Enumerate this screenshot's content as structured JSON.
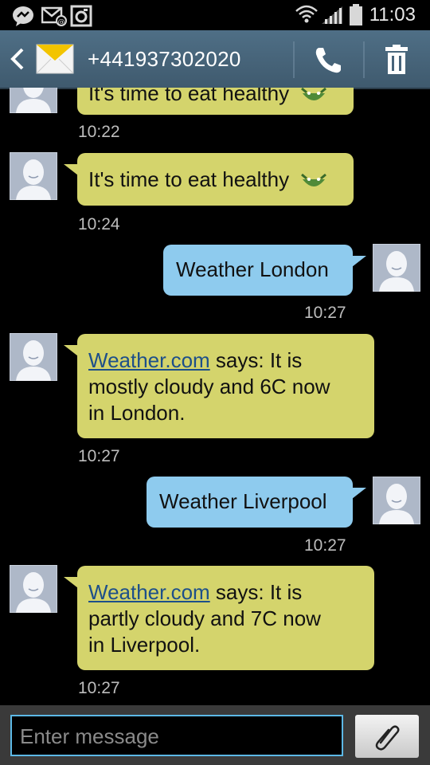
{
  "status_bar": {
    "time": "11:03",
    "icons": [
      "messenger-icon",
      "mail-notification-icon",
      "gallery-icon",
      "wifi-icon",
      "signal-icon",
      "battery-icon"
    ]
  },
  "header": {
    "contact_number": "+441937302020",
    "icons": [
      "back-arrow-icon",
      "envelope-icon",
      "phone-icon",
      "trash-icon"
    ]
  },
  "messages": [
    {
      "direction": "in",
      "text": "It's time to eat healthy",
      "time": "10:22",
      "emoji": "smiling-face-icon",
      "partially_visible": true
    },
    {
      "direction": "in",
      "text": "It's time to eat healthy",
      "time": "10:24",
      "emoji": "smiling-face-icon"
    },
    {
      "direction": "out",
      "text": "Weather London",
      "time": "10:27"
    },
    {
      "direction": "in",
      "link": "Weather.com",
      "line1_rest": " says: It is",
      "line2": "mostly cloudy and 6C now",
      "line3": "in London.",
      "time": "10:27"
    },
    {
      "direction": "out",
      "text": "Weather Liverpool",
      "time": "10:27"
    },
    {
      "direction": "in",
      "link": "Weather.com",
      "line1_rest": " says: It is",
      "line2": "partly cloudy and 7C now",
      "line3": "in Liverpool.",
      "time": "10:27"
    }
  ],
  "composer": {
    "placeholder": "Enter message",
    "attach_icon": "paperclip-icon"
  },
  "colors": {
    "incoming_bubble": "#d4d46c",
    "outgoing_bubble": "#8ecbee",
    "header": "#46637a",
    "input_border": "#5cb8e6",
    "link": "#1d4f8a"
  }
}
